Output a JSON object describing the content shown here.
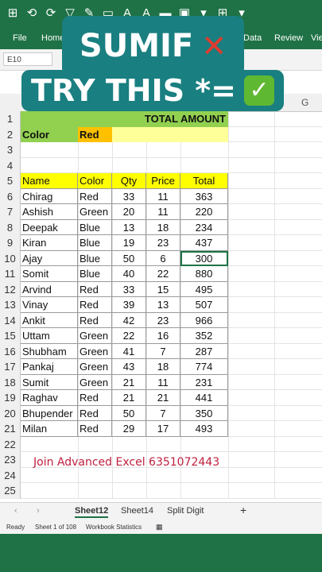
{
  "ribbon": {
    "quick_access": [
      "⊞",
      "⟲",
      "⟳",
      "▽",
      "✎",
      "▭",
      "A",
      "A",
      "▬",
      "▣",
      "▾",
      "⊞",
      "▾"
    ],
    "tabs": [
      "File",
      "Home",
      "Data",
      "Review",
      "Vie"
    ]
  },
  "name_box": "E10",
  "overlay": {
    "line1": "SUMIF",
    "line1_mark": "✕",
    "line2": "TRY THIS *=",
    "line2_mark": "✓"
  },
  "column_letters": [
    "G"
  ],
  "row_numbers": [
    "1",
    "2",
    "3",
    "4",
    "5",
    "6",
    "7",
    "8",
    "9",
    "10",
    "11",
    "12",
    "13",
    "14",
    "15",
    "16",
    "17",
    "18",
    "19",
    "20",
    "21",
    "22",
    "23",
    "24",
    "25"
  ],
  "sheet": {
    "total_amount_label": "TOTAL AMOUNT",
    "color_label": "Color",
    "color_value": "Red",
    "headers": [
      "Name",
      "Color",
      "Qty",
      "Price",
      "Total"
    ],
    "rows": [
      [
        "Chirag",
        "Red",
        "33",
        "11",
        "363"
      ],
      [
        "Ashish",
        "Green",
        "20",
        "11",
        "220"
      ],
      [
        "Deepak",
        "Blue",
        "13",
        "18",
        "234"
      ],
      [
        "Kiran",
        "Blue",
        "19",
        "23",
        "437"
      ],
      [
        "Ajay",
        "Blue",
        "50",
        "6",
        "300"
      ],
      [
        "Somit",
        "Blue",
        "40",
        "22",
        "880"
      ],
      [
        "Arvind",
        "Red",
        "33",
        "15",
        "495"
      ],
      [
        "Vinay",
        "Red",
        "39",
        "13",
        "507"
      ],
      [
        "Ankit",
        "Red",
        "42",
        "23",
        "966"
      ],
      [
        "Uttam",
        "Green",
        "22",
        "16",
        "352"
      ],
      [
        "Shubham",
        "Green",
        "41",
        "7",
        "287"
      ],
      [
        "Pankaj",
        "Green",
        "43",
        "18",
        "774"
      ],
      [
        "Sumit",
        "Green",
        "21",
        "11",
        "231"
      ],
      [
        "Raghav",
        "Red",
        "21",
        "21",
        "441"
      ],
      [
        "Bhupender",
        "Red",
        "50",
        "7",
        "350"
      ],
      [
        "Milan",
        "Red",
        "29",
        "17",
        "493"
      ]
    ]
  },
  "promo_text": "Join Advanced Excel 6351072443",
  "sheet_tabs": [
    "Sheet12",
    "Sheet14",
    "Split Digit"
  ],
  "sheet_nav": {
    "prev": "‹",
    "next": "›",
    "add": "+"
  },
  "status": {
    "ready": "Ready",
    "sheet_of": "Sheet 1 of 108",
    "workbook_stats": "Workbook Statistics"
  },
  "colors": {
    "excel_green": "#1f7246",
    "overlay_teal": "#1a7f80",
    "header_yellow": "#ffff00",
    "label_green": "#92d050",
    "value_orange": "#ffc000"
  }
}
